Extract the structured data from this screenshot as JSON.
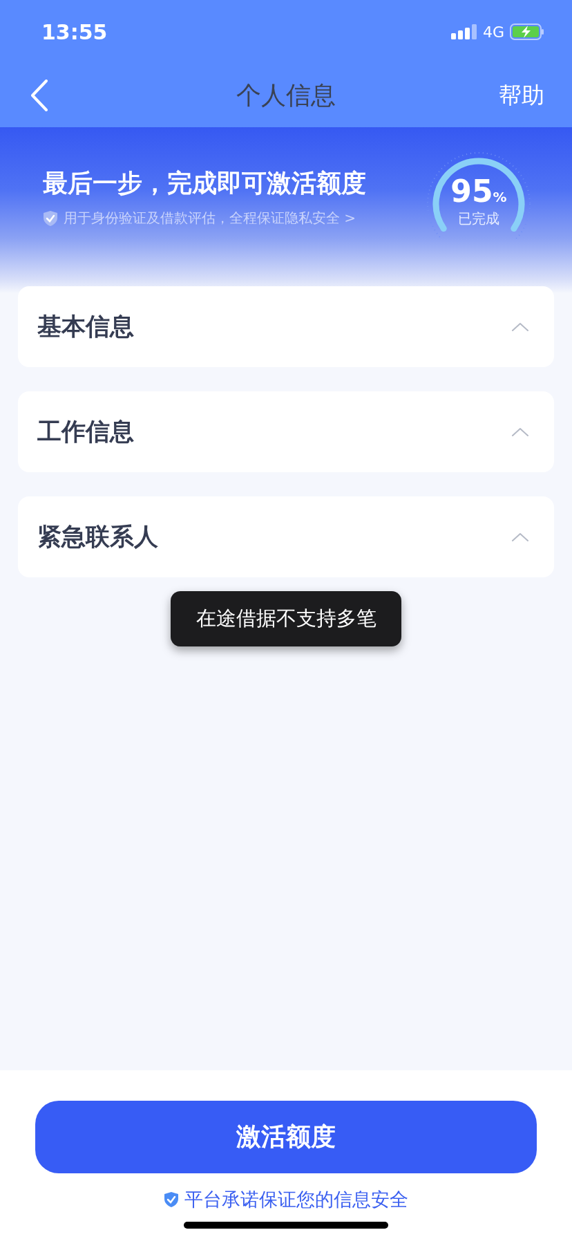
{
  "status_bar": {
    "time": "13:55",
    "network": "4G"
  },
  "nav": {
    "title": "个人信息",
    "action": "帮助"
  },
  "hero": {
    "headline": "最后一步，完成即可激活额度",
    "note": "用于身份验证及借款评估，全程保证隐私安全 >",
    "progress": {
      "value": "95",
      "unit": "%",
      "caption": "已完成"
    }
  },
  "sections": [
    {
      "title": "基本信息"
    },
    {
      "title": "工作信息"
    },
    {
      "title": "紧急联系人"
    }
  ],
  "toast": "在途借据不支持多笔",
  "primary_button": "激活额度",
  "footer_note": "平台承诺保证您的信息安全"
}
